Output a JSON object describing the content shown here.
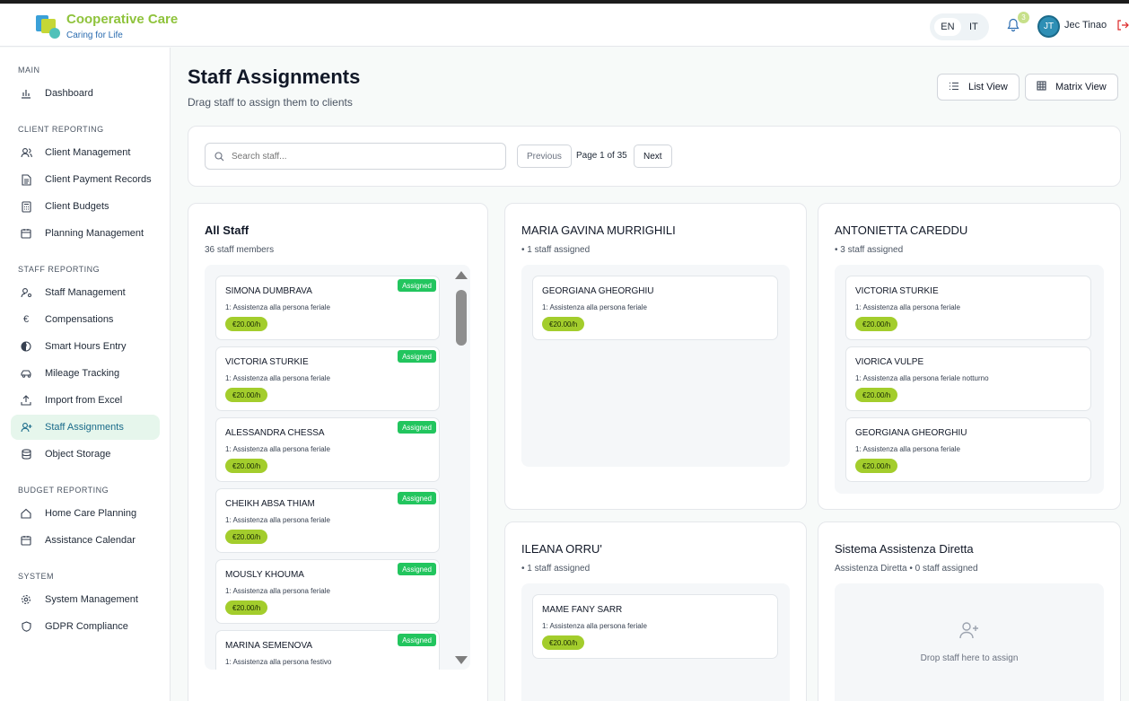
{
  "header": {
    "brand_title": "Cooperative Care",
    "brand_subtitle": "Caring for Life",
    "languages": [
      "EN",
      "IT"
    ],
    "active_language": "EN",
    "notification_count": "3",
    "user_initials": "JT",
    "user_name": "Jec Tinao"
  },
  "sidebar": {
    "sections": [
      {
        "title": "MAIN",
        "items": [
          {
            "label": "Dashboard",
            "icon": "bar-chart-icon"
          }
        ]
      },
      {
        "title": "CLIENT REPORTING",
        "items": [
          {
            "label": "Client Management",
            "icon": "users-icon"
          },
          {
            "label": "Client Payment Records",
            "icon": "document-icon"
          },
          {
            "label": "Client Budgets",
            "icon": "calculator-icon"
          },
          {
            "label": "Planning Management",
            "icon": "calendar-icon"
          }
        ]
      },
      {
        "title": "STAFF REPORTING",
        "items": [
          {
            "label": "Staff Management",
            "icon": "user-cog-icon"
          },
          {
            "label": "Compensations",
            "icon": "euro-icon"
          },
          {
            "label": "Smart Hours Entry",
            "icon": "clock-icon"
          },
          {
            "label": "Mileage Tracking",
            "icon": "car-icon"
          },
          {
            "label": "Import from Excel",
            "icon": "upload-icon"
          },
          {
            "label": "Staff Assignments",
            "icon": "user-plus-icon",
            "active": true
          },
          {
            "label": "Object Storage",
            "icon": "database-icon"
          }
        ]
      },
      {
        "title": "BUDGET REPORTING",
        "items": [
          {
            "label": "Home Care Planning",
            "icon": "home-icon"
          },
          {
            "label": "Assistance Calendar",
            "icon": "calendar-icon"
          }
        ]
      },
      {
        "title": "SYSTEM",
        "items": [
          {
            "label": "System Management",
            "icon": "gear-icon"
          },
          {
            "label": "GDPR Compliance",
            "icon": "shield-icon"
          }
        ]
      }
    ]
  },
  "page": {
    "title": "Staff Assignments",
    "subtitle": "Drag staff to assign them to clients",
    "list_view_label": "List View",
    "matrix_view_label": "Matrix View"
  },
  "toolbar": {
    "search_placeholder": "Search staff...",
    "previous_label": "Previous",
    "page_info": "Page 1 of 35",
    "next_label": "Next"
  },
  "all_staff": {
    "title": "All Staff",
    "count_text": "36 staff members",
    "assigned_tag": "Assigned",
    "staff": [
      {
        "name": "SIMONA DUMBRAVA",
        "role": "1: Assistenza alla persona feriale",
        "rate": "€20.00/h"
      },
      {
        "name": "VICTORIA STURKIE",
        "role": "1: Assistenza alla persona feriale",
        "rate": "€20.00/h"
      },
      {
        "name": "ALESSANDRA CHESSA",
        "role": "1: Assistenza alla persona feriale",
        "rate": "€20.00/h"
      },
      {
        "name": "CHEIKH ABSA THIAM",
        "role": "1: Assistenza alla persona feriale",
        "rate": "€20.00/h"
      },
      {
        "name": "MOUSLY KHOUMA",
        "role": "1: Assistenza alla persona feriale",
        "rate": "€20.00/h"
      },
      {
        "name": "MARINA SEMENOVA",
        "role": "1: Assistenza alla persona festivo",
        "rate": ""
      }
    ]
  },
  "clients": [
    {
      "name": "MARIA GAVINA MURRIGHILI",
      "sub": "• 1 staff assigned",
      "staff": [
        {
          "name": "GEORGIANA GHEORGHIU",
          "role": "1: Assistenza alla persona feriale",
          "rate": "€20.00/h"
        }
      ]
    },
    {
      "name": "ANTONIETTA CAREDDU",
      "sub": "• 3 staff assigned",
      "staff": [
        {
          "name": "VICTORIA STURKIE",
          "role": "1: Assistenza alla persona feriale",
          "rate": "€20.00/h"
        },
        {
          "name": "VIORICA VULPE",
          "role": "1: Assistenza alla persona feriale notturno",
          "rate": "€20.00/h"
        },
        {
          "name": "GEORGIANA GHEORGHIU",
          "role": "1: Assistenza alla persona feriale",
          "rate": "€20.00/h"
        }
      ]
    },
    {
      "name": "ILEANA ORRU'",
      "sub": "• 1 staff assigned",
      "staff": [
        {
          "name": "MAME FANY SARR",
          "role": "1: Assistenza alla persona feriale",
          "rate": "€20.00/h"
        }
      ]
    },
    {
      "name": "Sistema Assistenza Diretta",
      "sub": "Assistenza Diretta • 0 staff assigned",
      "drop_hint": "Drop staff here to assign",
      "staff": []
    }
  ],
  "colors": {
    "brand_green": "#8fc33c",
    "accent_teal": "#1a6b8a",
    "assigned_green": "#22c55e",
    "rate_lime": "#a3cd2c"
  }
}
